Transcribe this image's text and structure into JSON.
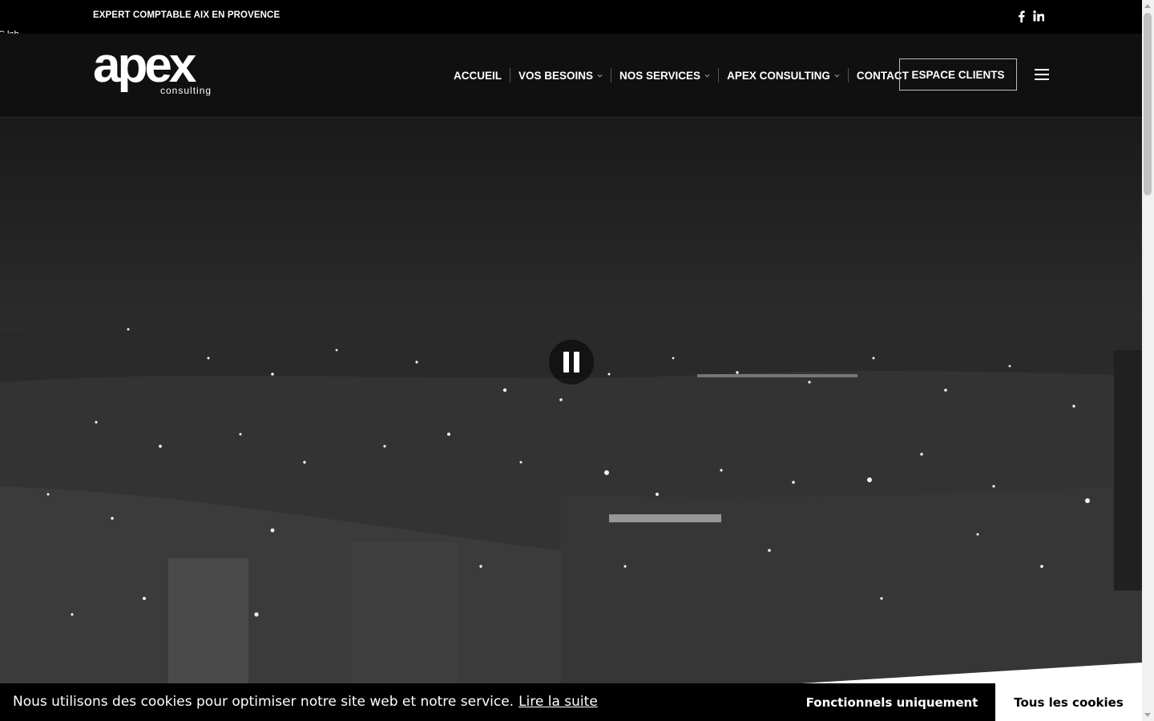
{
  "topbar": {
    "tagline": "EXPERT COMPTABLE AIX EN PROVENCE",
    "social_icons": [
      "facebook-icon",
      "linkedin-icon"
    ]
  },
  "stray_text": "C lab.",
  "header": {
    "logo_word": "apex",
    "logo_sub": "consulting",
    "nav": [
      {
        "label": "ACCUEIL",
        "dropdown": false
      },
      {
        "label": "VOS BESOINS",
        "dropdown": true
      },
      {
        "label": "NOS SERVICES",
        "dropdown": true
      },
      {
        "label": "APEX CONSULTING",
        "dropdown": true
      },
      {
        "label": "CONTACT",
        "dropdown": false
      }
    ],
    "cta_label": "ESPACE CLIENTS",
    "menu_icon": "hamburger-icon"
  },
  "hero": {
    "video_control_icon": "pause-icon"
  },
  "cookie_bar": {
    "message": "Nous utilisons des cookies pour optimiser notre site web et notre service.",
    "link_label": "Lire la suite",
    "functional_label": "Fonctionnels uniquement",
    "accept_all_label": "Tous les cookies"
  },
  "colors": {
    "topbar_bg": "#000000",
    "header_bg": "#101010",
    "cookie_bg": "#000000",
    "accent_button_bg": "#ffffff"
  }
}
